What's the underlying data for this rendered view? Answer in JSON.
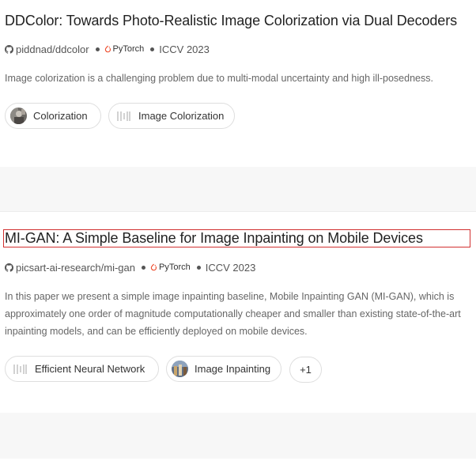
{
  "papers": [
    {
      "title": "DDColor: Towards Photo-Realistic Image Colorization via Dual Decoders",
      "repo": "piddnad/ddcolor",
      "framework": "PyTorch",
      "venue": "ICCV 2023",
      "description": "Image colorization is a challenging problem due to multi-modal uncertainty and high ill-posedness.",
      "tasks": [
        {
          "label": "Colorization",
          "icon": "colorization-thumbnail-icon"
        },
        {
          "label": "Image Colorization",
          "icon": "placeholder-bars-icon"
        }
      ]
    },
    {
      "title": "MI-GAN: A Simple Baseline for Image Inpainting on Mobile Devices",
      "repo": "picsart-ai-research/mi-gan",
      "framework": "PyTorch",
      "venue": "ICCV 2023",
      "description": "In this paper we present a simple image inpainting baseline, Mobile Inpainting GAN (MI-GAN), which is approximately one order of magnitude computationally cheaper and smaller than existing state-of-the-art inpainting models, and can be efficiently deployed on mobile devices.",
      "tasks": [
        {
          "label": "Efficient Neural Network",
          "icon": "placeholder-bars-icon"
        },
        {
          "label": "Image Inpainting",
          "icon": "inpainting-thumbnail-icon"
        }
      ],
      "more_tasks": "+1"
    }
  ],
  "colors": {
    "highlight_border": "#d23030",
    "pytorch_orange": "#ee4c2c",
    "separator_gap": "#f7f7f7"
  }
}
